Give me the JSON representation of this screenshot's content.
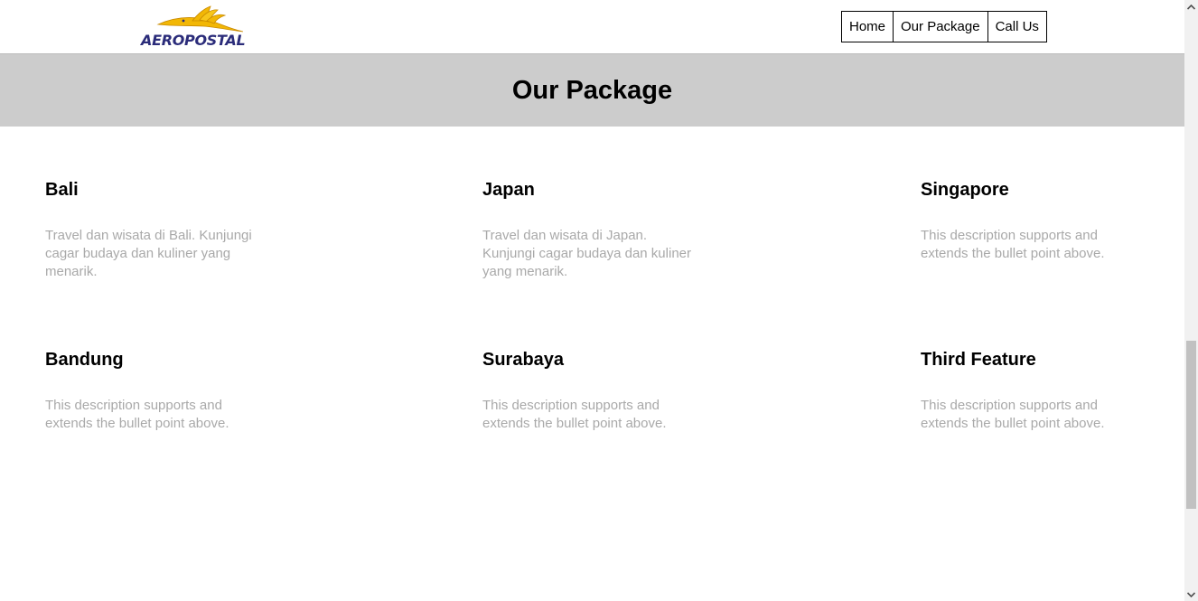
{
  "brand": {
    "logo_text": "AEROPOSTAL",
    "logo_colors": {
      "bird": "#f2b705",
      "text": "#2b2c7a"
    }
  },
  "nav": {
    "items": [
      "Home",
      "Our Package",
      "Call Us"
    ]
  },
  "banner": {
    "title": "Our Package",
    "background": "#cccccc"
  },
  "packages": [
    {
      "title": "Bali",
      "description": "Travel dan wisata di Bali. Kunjungi cagar budaya dan kuliner yang menarik."
    },
    {
      "title": "Japan",
      "description": "Travel dan wisata di Japan. Kunjungi cagar budaya dan kuliner yang menarik."
    },
    {
      "title": "Singapore",
      "description": "This description supports and extends the bullet point above."
    },
    {
      "title": "Bandung",
      "description": "This description supports and extends the bullet point above."
    },
    {
      "title": "Surabaya",
      "description": "This description supports and extends the bullet point above."
    },
    {
      "title": "Third Feature",
      "description": "This description supports and extends the bullet point above."
    }
  ],
  "scrollbar": {
    "up_icon": "chevron-up-icon",
    "down_icon": "chevron-down-icon"
  }
}
